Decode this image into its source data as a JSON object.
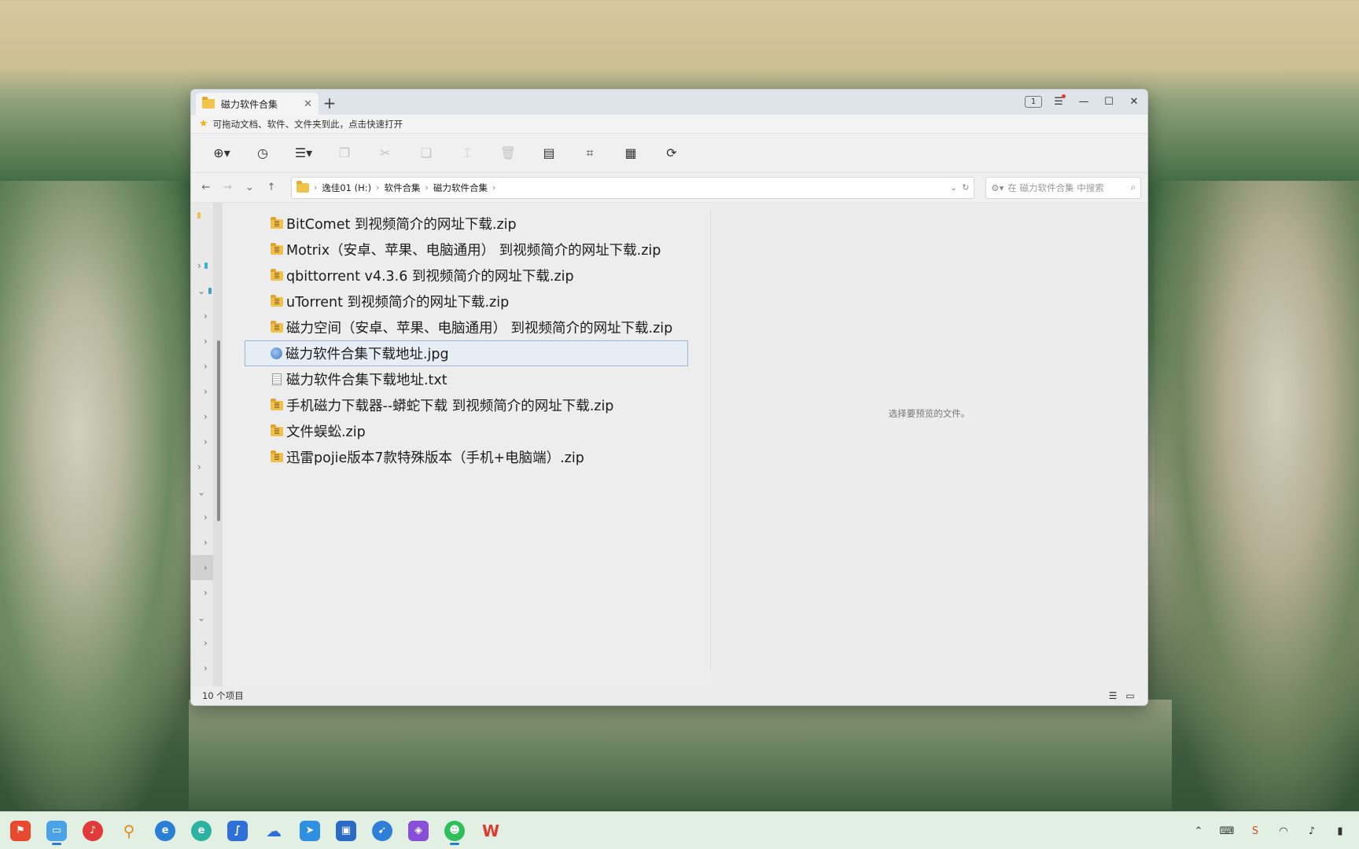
{
  "tab": {
    "title": "磁力软件合集",
    "close": "✕",
    "new": "+"
  },
  "window_controls": {
    "badge": "1",
    "menu": "☰",
    "minimize": "—",
    "maximize": "☐",
    "close": "✕"
  },
  "quickbar": {
    "text": "可拖动文档、软件、文件夹到此，点击快速打开"
  },
  "toolbar": {
    "icons": [
      "new-icon",
      "history-icon",
      "view-menu-icon",
      "copy-icon",
      "cut-icon",
      "paste-icon",
      "rename-icon",
      "delete-icon",
      "properties-icon",
      "crop-icon",
      "calculator-icon",
      "refresh-sync-icon"
    ]
  },
  "address": {
    "crumbs": [
      "逸佳01 (H:)",
      "软件合集",
      "磁力软件合集"
    ]
  },
  "search": {
    "placeholder": "在 磁力软件合集 中搜索"
  },
  "files": [
    {
      "name": "BitComet  到视频简介的网址下载.zip",
      "type": "zip"
    },
    {
      "name": "Motrix（安卓、苹果、电脑通用） 到视频简介的网址下载.zip",
      "type": "zip"
    },
    {
      "name": "qbittorrent v4.3.6  到视频简介的网址下载.zip",
      "type": "zip"
    },
    {
      "name": "uTorrent  到视频简介的网址下载.zip",
      "type": "zip"
    },
    {
      "name": "磁力空间（安卓、苹果、电脑通用） 到视频简介的网址下载.zip",
      "type": "zip"
    },
    {
      "name": "磁力软件合集下载地址.jpg",
      "type": "jpg",
      "selected": true
    },
    {
      "name": "磁力软件合集下载地址.txt",
      "type": "txt"
    },
    {
      "name": "手机磁力下载器--蟒蛇下载  到视频简介的网址下载.zip",
      "type": "zip"
    },
    {
      "name": "文件蜈蚣.zip",
      "type": "zip"
    },
    {
      "name": "迅雷pojie版本7款特殊版本（手机+电脑端）.zip",
      "type": "zip"
    }
  ],
  "preview": {
    "text": "选择要预览的文件。"
  },
  "status": {
    "count": "10 个项目"
  },
  "colors": {
    "accent": "#2a7bd4",
    "selection_border": "#9cb8d6",
    "folder": "#f3c24a"
  }
}
